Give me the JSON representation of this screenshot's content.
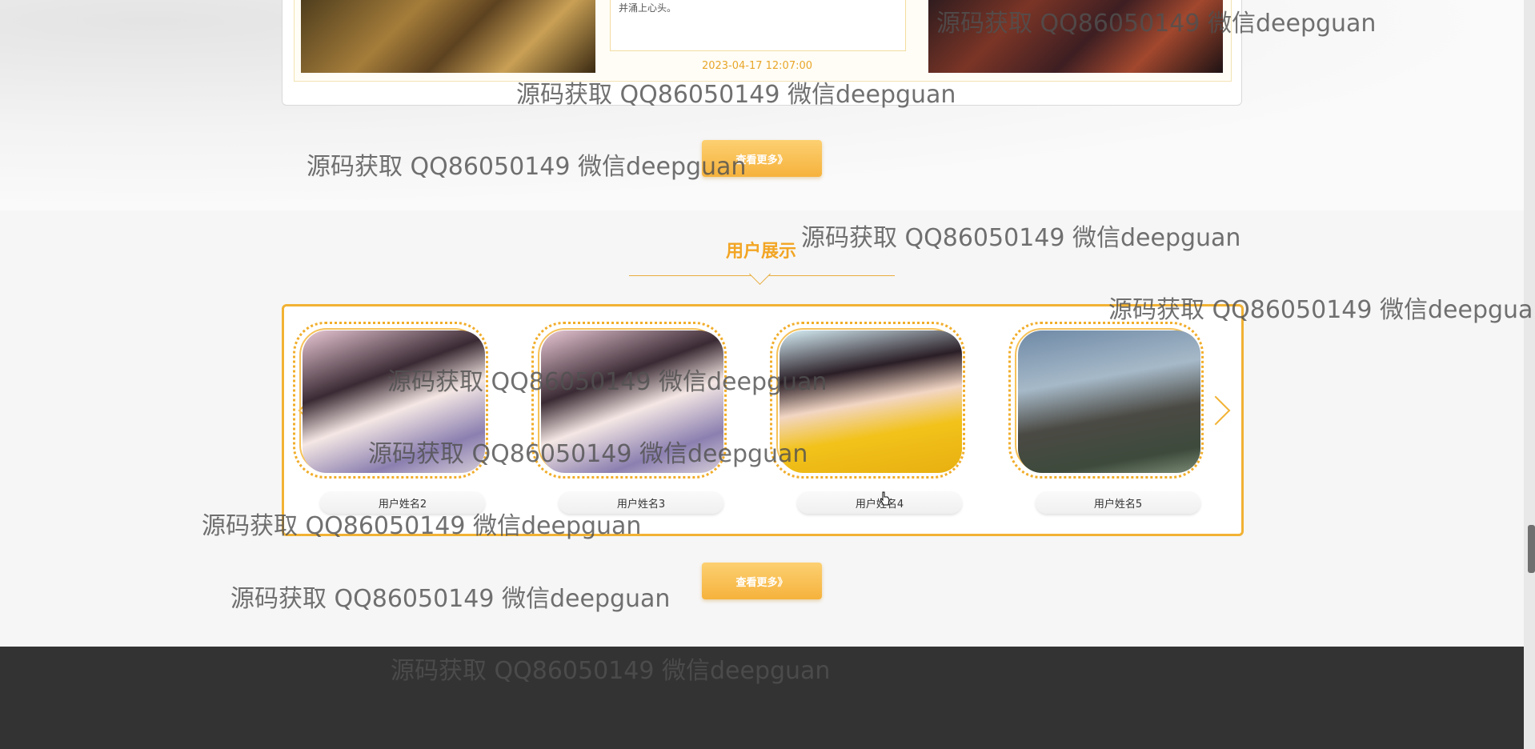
{
  "news": {
    "text_snippet": "并涌上心头。",
    "date": "2023-04-17 12:07:00",
    "more_label": "查看更多》"
  },
  "users_section": {
    "title": "用户展示",
    "users": [
      {
        "name": "用户姓名2"
      },
      {
        "name": "用户姓名3"
      },
      {
        "name": "用户姓名4"
      },
      {
        "name": "用户姓名5"
      }
    ],
    "more_label": "查看更多》"
  },
  "watermark_text": "源码获取 QQ86050149 微信deepguan",
  "colors": {
    "accent": "#f2a524",
    "footer": "#333333"
  }
}
